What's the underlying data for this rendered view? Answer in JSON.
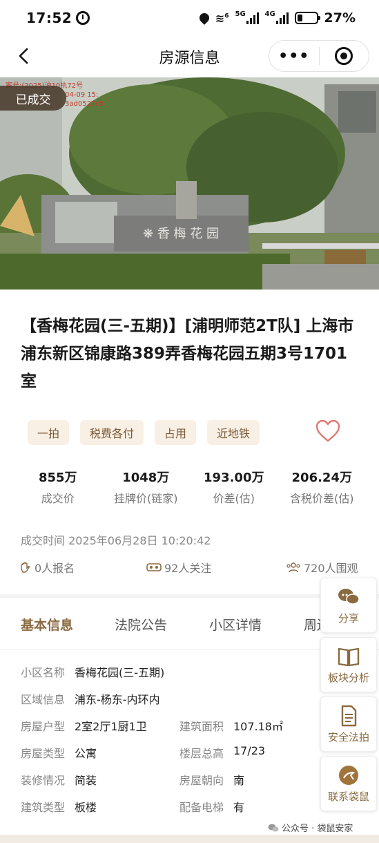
{
  "status_bar": {
    "time": "17:52",
    "battery": "27%",
    "signal1": "5G",
    "signal2": "4G",
    "wifi": "6",
    "battery_level": 0.27
  },
  "nav": {
    "title": "房源信息",
    "more": "•••"
  },
  "hero": {
    "badge": "已成交",
    "watermark_line1": "案号:(2025)沪10执72号",
    "watermark_line2": "04-09 15:",
    "watermark_line3": "3ad0527c5"
  },
  "title": "【香梅花园(三-五期)】[浦明师范2T队] 上海市浦东新区锦康路389弄香梅花园五期3号1701室",
  "tags": [
    "一拍",
    "税费各付",
    "占用",
    "近地铁"
  ],
  "prices": [
    {
      "value": "855万",
      "label": "成交价"
    },
    {
      "value": "1048万",
      "label": "挂牌价(链家)"
    },
    {
      "value": "193.00万",
      "label": "价差(估)"
    },
    {
      "value": "206.24万",
      "label": "含税价差(估)"
    }
  ],
  "deal_time": "成交时间 2025年06月28日 10:20:42",
  "stats": {
    "signup": "0人报名",
    "follow": "92人关注",
    "watch": "720人围观"
  },
  "tabs": [
    "基本信息",
    "法院公告",
    "小区详情",
    "周边"
  ],
  "info": {
    "community_k": "小区名称",
    "community_v": "香梅花园(三-五期)",
    "region_k": "区域信息",
    "region_v": "浦东-杨东-内环内",
    "layout_k": "房屋户型",
    "layout_v": "2室2厅1厨1卫",
    "area_k": "建筑面积",
    "area_v": "107.18㎡",
    "type_k": "房屋类型",
    "type_v": "公寓",
    "floor_k": "楼层总高",
    "floor_v": "17/23",
    "deco_k": "装修情况",
    "deco_v": "简装",
    "orient_k": "房屋朝向",
    "orient_v": "南",
    "build_k": "建筑类型",
    "build_v": "板楼",
    "elev_k": "配备电梯",
    "elev_v": "有"
  },
  "sidebar": {
    "share": "分享",
    "analysis": "板块分析",
    "safe": "安全法拍",
    "contact": "联系袋鼠"
  },
  "footer": {
    "mark": "公众号 · 袋鼠安家"
  },
  "colors": {
    "accent": "#8a6a40",
    "tag_bg": "#f8f0e5",
    "heart": "#e07a70"
  }
}
